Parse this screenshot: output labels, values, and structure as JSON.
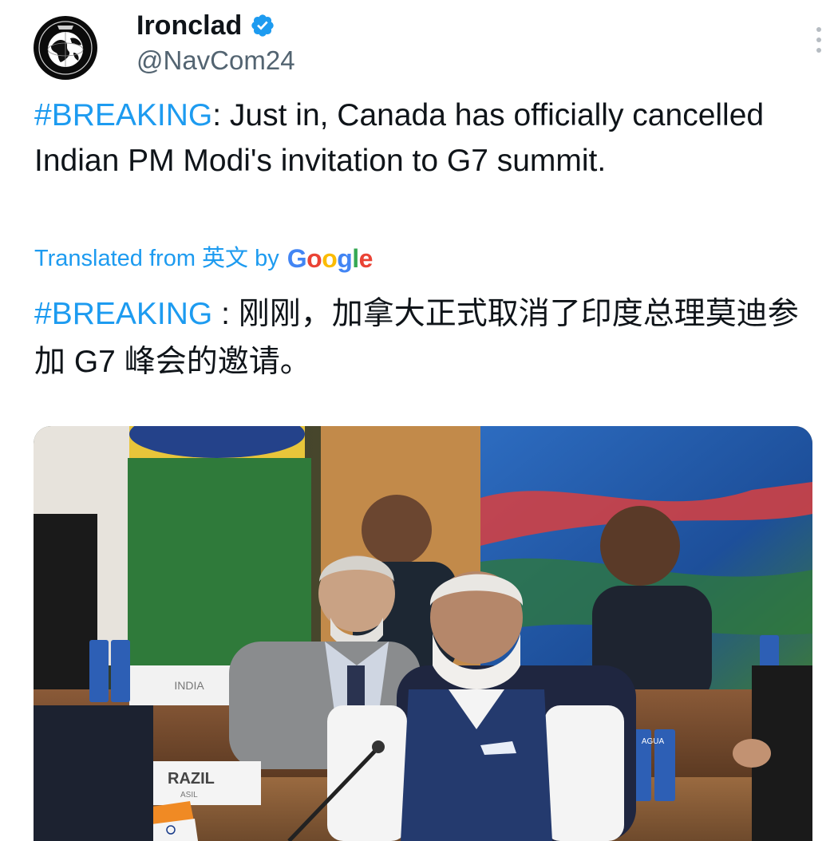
{
  "author": {
    "display_name": "Ironclad",
    "handle": "@NavCom24",
    "avatar_icon": "globe-emblem-icon",
    "verified_icon": "verified-badge-icon"
  },
  "tweet": {
    "hashtag": "#BREAKING",
    "text": ": Just in, Canada has officially cancelled Indian PM Modi's invitation to G7 summit."
  },
  "translation": {
    "label": "Translated from 英文 by",
    "provider_letters": [
      "G",
      "o",
      "o",
      "g",
      "l",
      "e"
    ],
    "hashtag": "#BREAKING",
    "text": " : 刚刚，加拿大正式取消了印度总理莫迪参加 G7 峰会的邀请。"
  },
  "media": {
    "name_card_1": "INDIA",
    "name_card_2": "RAZIL",
    "name_card_2_sub": "ASIL",
    "can_label": "AGUA"
  },
  "colors": {
    "link": "#1d9bf0",
    "verified": "#1d9bf0",
    "handle": "#536471"
  }
}
